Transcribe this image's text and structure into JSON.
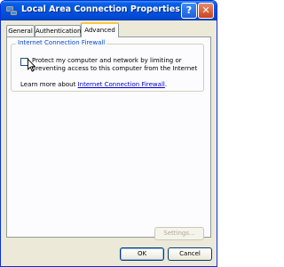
{
  "window": {
    "title": "Local Area Connection Properties",
    "help_label": "?",
    "close_label": "✕"
  },
  "tabs": [
    {
      "label": "General",
      "selected": false
    },
    {
      "label": "Authentication",
      "selected": false
    },
    {
      "label": "Advanced",
      "selected": true
    }
  ],
  "firewall": {
    "group_title": "Internet Connection Firewall",
    "checkbox_label": "Protect my computer and network by limiting or preventing access to this computer from the Internet",
    "checked": false,
    "learn_prefix": "Learn more about ",
    "learn_link": "Internet Connection Firewall",
    "learn_suffix": "."
  },
  "buttons": {
    "settings": "Settings...",
    "ok": "OK",
    "cancel": "Cancel"
  },
  "colors": {
    "titlebar": "#0054e3",
    "dialog_bg": "#ece9d8",
    "group_title": "#0046d5",
    "link": "#0000cc"
  }
}
